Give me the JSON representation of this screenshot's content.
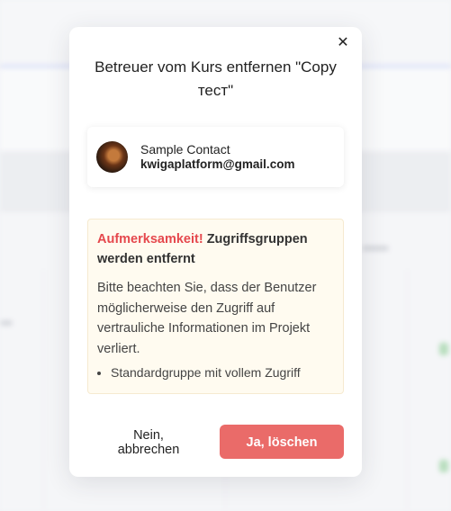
{
  "modal": {
    "title": "Betreuer vom Kurs entfernen \"Copy тест\"",
    "close_icon": "close-icon"
  },
  "contact": {
    "name": "Sample Contact",
    "email": "kwigaplatform@gmail.com",
    "avatar_icon": "avatar"
  },
  "alert": {
    "warning_label": "Aufmerksamkeit!",
    "heading_rest": " Zugriffsgruppen werden entfernt",
    "body": "Bitte beachten Sie, dass der Benutzer möglicherweise den Zugriff auf vertrauliche Informationen im Projekt verliert.",
    "groups": [
      "Standardgruppe mit vollem Zugriff"
    ]
  },
  "buttons": {
    "cancel_label": "Nein, abbrechen",
    "delete_label": "Ja, löschen"
  },
  "colors": {
    "accent": "#ea6b69",
    "warning_text": "#e5484d",
    "alert_bg": "#fffbf0"
  }
}
